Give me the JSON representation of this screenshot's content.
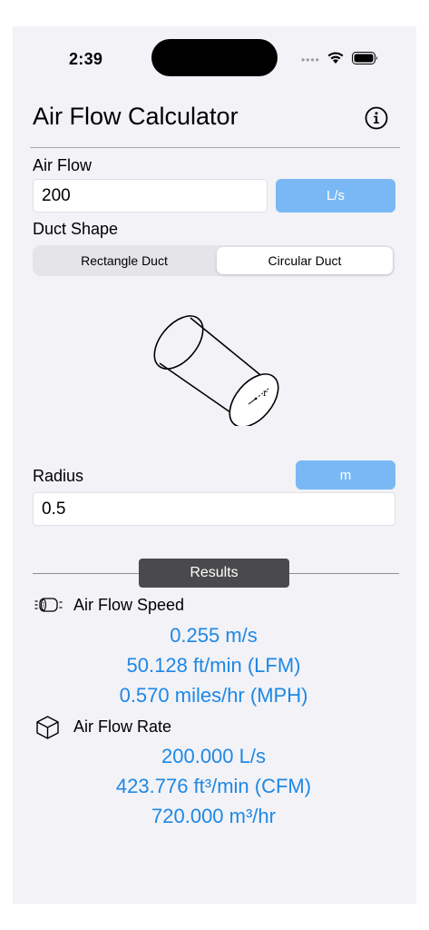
{
  "status_bar": {
    "time": "2:39"
  },
  "header": {
    "title": "Air Flow Calculator"
  },
  "air_flow": {
    "label": "Air Flow",
    "value": "200",
    "unit": "L/s"
  },
  "duct_shape": {
    "label": "Duct Shape",
    "options": [
      "Rectangle Duct",
      "Circular Duct"
    ],
    "selected": "Circular Duct",
    "diagram_label": "r"
  },
  "radius": {
    "label": "Radius",
    "value": "0.5",
    "unit": "m"
  },
  "results": {
    "tag": "Results",
    "speed": {
      "label": "Air Flow Speed",
      "values": [
        "0.255 m/s",
        "50.128 ft/min (LFM)",
        "0.570 miles/hr (MPH)"
      ]
    },
    "rate": {
      "label": "Air Flow Rate",
      "values": [
        "200.000 L/s",
        "423.776 ft³/min (CFM)",
        "720.000 m³/hr"
      ]
    }
  },
  "colors": {
    "accent_button": "#7ab8f5",
    "result_text": "#1e88e5",
    "results_tag": "#4a4a4c"
  },
  "icons": [
    "info-icon",
    "wifi-icon",
    "battery-icon",
    "speed-icon",
    "box-icon"
  ]
}
